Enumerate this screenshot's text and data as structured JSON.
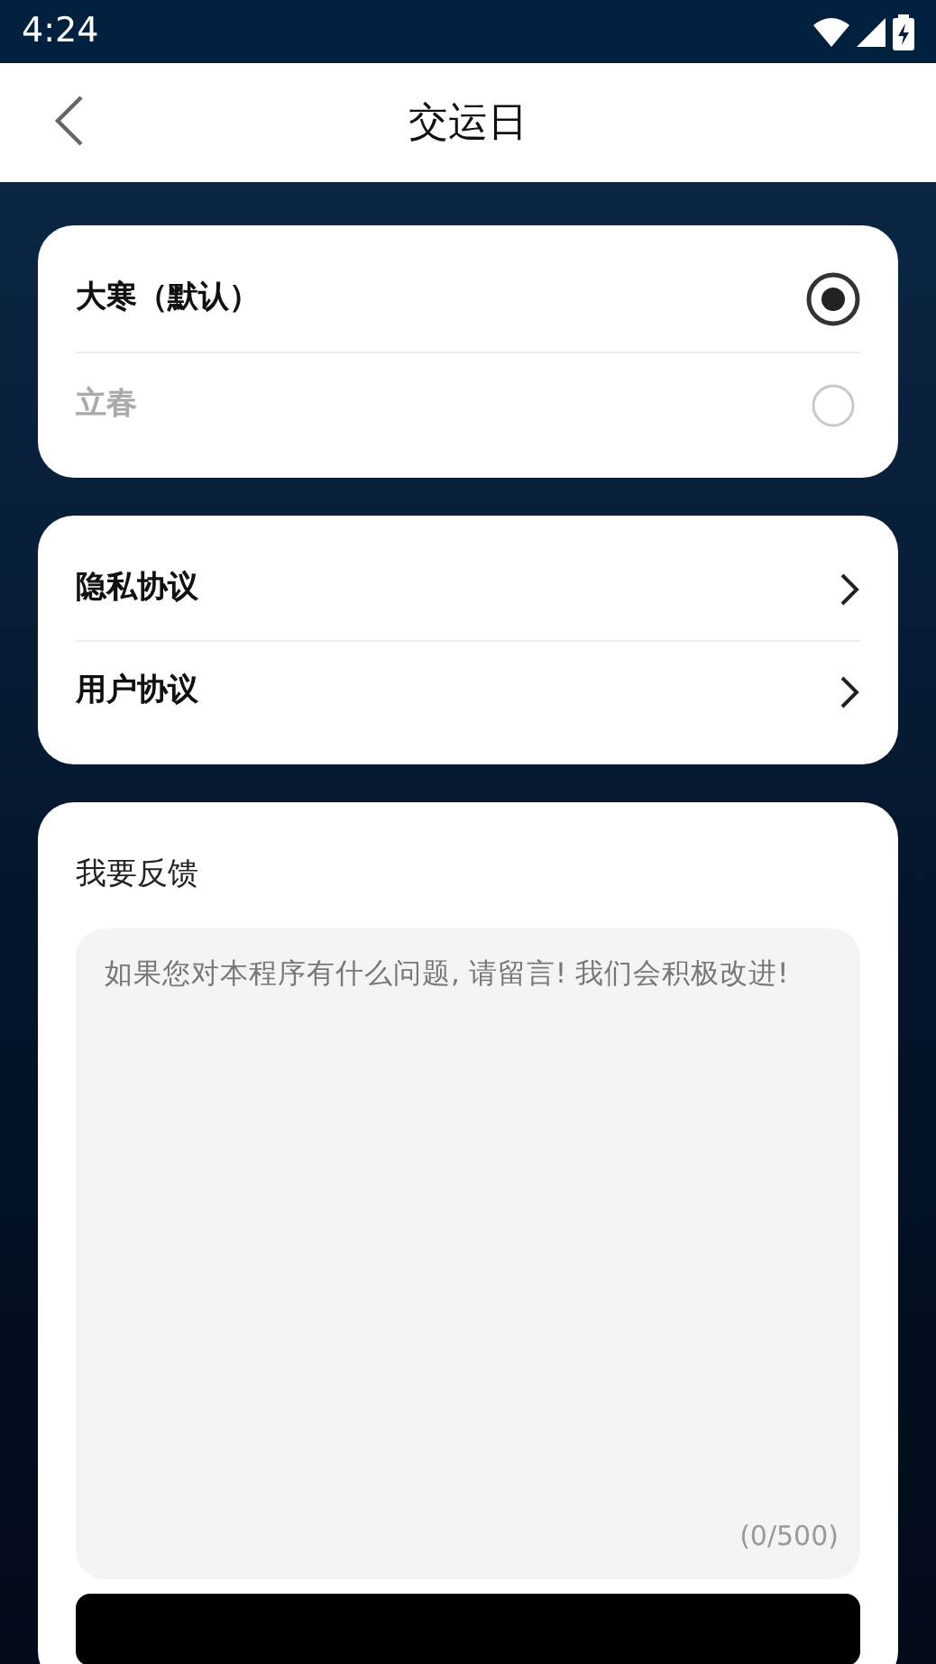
{
  "status_bar": {
    "time": "4:24"
  },
  "header": {
    "title": "交运日"
  },
  "options": [
    {
      "label": "大寒（默认）",
      "selected": true
    },
    {
      "label": "立春",
      "selected": false
    }
  ],
  "links": [
    {
      "label": "隐私协议"
    },
    {
      "label": "用户协议"
    }
  ],
  "feedback": {
    "title": "我要反馈",
    "placeholder": "如果您对本程序有什么问题, 请留言! 我们会积极改进!",
    "counter": "(0/500)"
  }
}
